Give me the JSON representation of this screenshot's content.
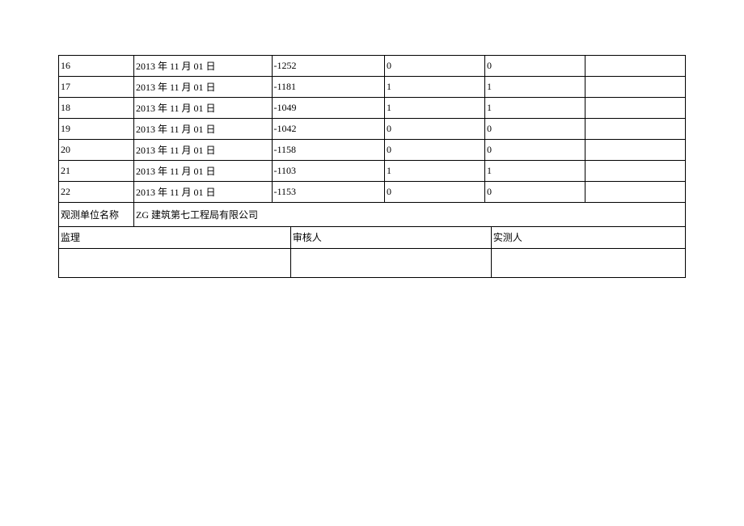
{
  "rows": [
    {
      "no": "16",
      "date": "2013 年 11 月 01 日",
      "v1": "-1252",
      "v2": "0",
      "v3": "0",
      "v4": ""
    },
    {
      "no": "17",
      "date": "2013 年 11 月 01 日",
      "v1": "-1181",
      "v2": "1",
      "v3": "1",
      "v4": ""
    },
    {
      "no": "18",
      "date": "2013 年 11 月 01 日",
      "v1": "-1049",
      "v2": "1",
      "v3": "1",
      "v4": ""
    },
    {
      "no": "19",
      "date": "2013 年 11 月 01 日",
      "v1": "-1042",
      "v2": "0",
      "v3": "0",
      "v4": ""
    },
    {
      "no": "20",
      "date": "2013 年 11 月 01 日",
      "v1": "-1158",
      "v2": "0",
      "v3": "0",
      "v4": ""
    },
    {
      "no": "21",
      "date": "2013 年 11 月 01 日",
      "v1": "-1103",
      "v2": "1",
      "v3": "1",
      "v4": ""
    },
    {
      "no": "22",
      "date": "2013 年 11 月 01 日",
      "v1": "-1153",
      "v2": "0",
      "v3": "0",
      "v4": ""
    }
  ],
  "org": {
    "label": "观测单位名称",
    "value": "ZG 建筑第七工程局有限公司"
  },
  "signoff": {
    "supervisor": "监理",
    "reviewer": "审核人",
    "measurer": "实测人"
  }
}
